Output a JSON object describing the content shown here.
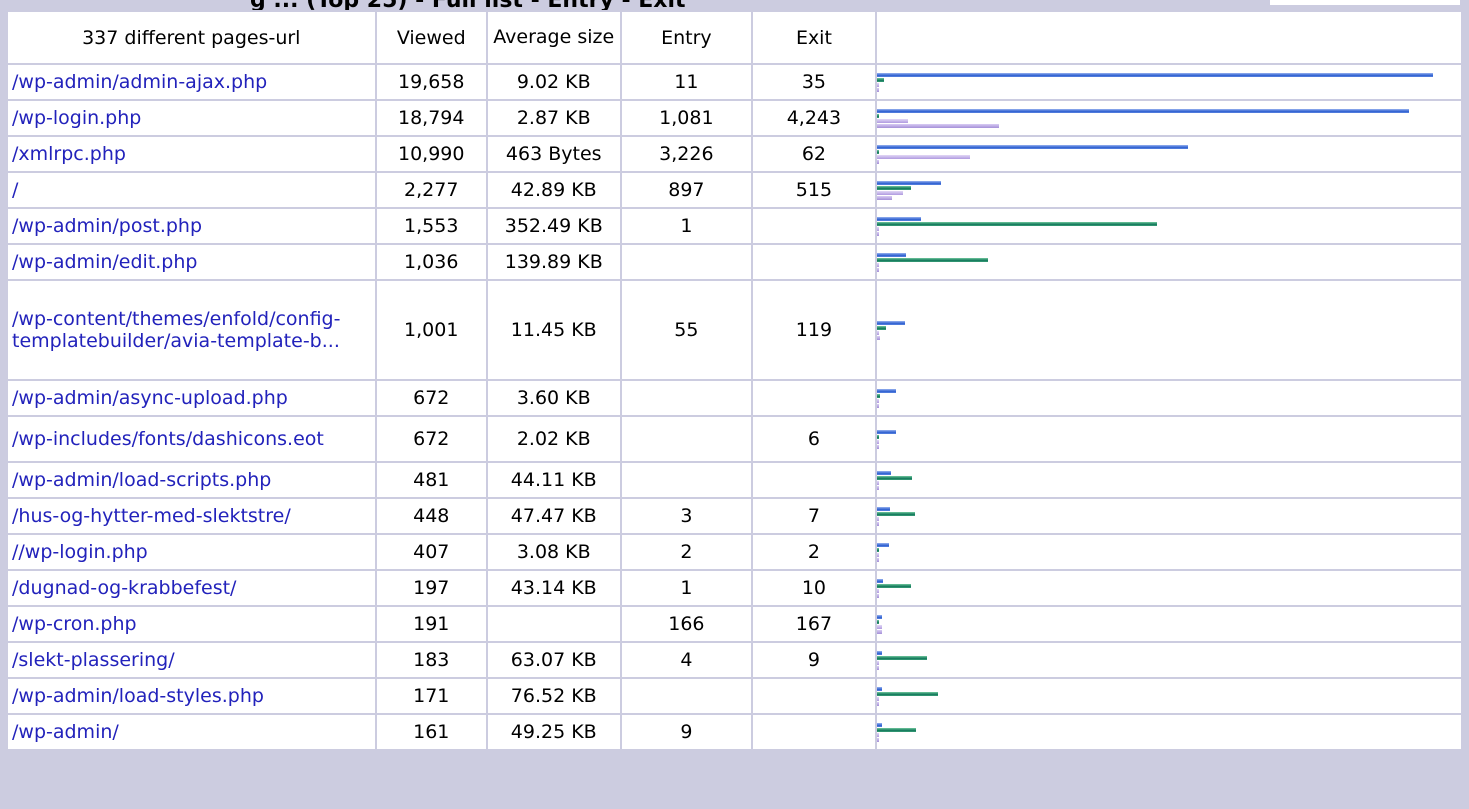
{
  "header_partial_title": "g ... (Top 25) - Full list - Entry - Exit",
  "table": {
    "headers": {
      "url": "337 different pages-url",
      "viewed": "Viewed",
      "size": "Average size",
      "entry": "Entry",
      "exit": "Exit"
    },
    "colors": {
      "viewed": "#4477dd",
      "size": "#2e9e5a",
      "entry": "#c9bde8",
      "exit": "#b8a8e0",
      "link": "#2222bb"
    },
    "rows": [
      {
        "url": "/wp-admin/admin-ajax.php",
        "viewed": "19,658",
        "size": "9.02 KB",
        "entry": "11",
        "exit": "35",
        "bv": 19658,
        "bs": 9.02,
        "be": 11,
        "bx": 35
      },
      {
        "url": "/wp-login.php",
        "viewed": "18,794",
        "size": "2.87 KB",
        "entry": "1,081",
        "exit": "4,243",
        "bv": 18794,
        "bs": 2.87,
        "be": 1081,
        "bx": 4243
      },
      {
        "url": "/xmlrpc.php",
        "viewed": "10,990",
        "size": "463 Bytes",
        "entry": "3,226",
        "exit": "62",
        "bv": 10990,
        "bs": 0.45,
        "be": 3226,
        "bx": 62
      },
      {
        "url": "/",
        "viewed": "2,277",
        "size": "42.89 KB",
        "entry": "897",
        "exit": "515",
        "bv": 2277,
        "bs": 42.89,
        "be": 897,
        "bx": 515
      },
      {
        "url": "/wp-admin/post.php",
        "viewed": "1,553",
        "size": "352.49 KB",
        "entry": "1",
        "exit": "",
        "bv": 1553,
        "bs": 352.49,
        "be": 1,
        "bx": 0
      },
      {
        "url": "/wp-admin/edit.php",
        "viewed": "1,036",
        "size": "139.89 KB",
        "entry": "",
        "exit": "",
        "bv": 1036,
        "bs": 139.89,
        "be": 0,
        "bx": 0
      },
      {
        "url": "/wp-content/themes/enfold/config-templatebuilder/avia-template-b...",
        "viewed": "1,001",
        "size": "11.45 KB",
        "entry": "55",
        "exit": "119",
        "bv": 1001,
        "bs": 11.45,
        "be": 55,
        "bx": 119
      },
      {
        "url": "/wp-admin/async-upload.php",
        "viewed": "672",
        "size": "3.60 KB",
        "entry": "",
        "exit": "",
        "bv": 672,
        "bs": 3.6,
        "be": 0,
        "bx": 0
      },
      {
        "url": "/wp-includes/fonts/dashicons.eot",
        "viewed": "672",
        "size": "2.02 KB",
        "entry": "",
        "exit": "6",
        "bv": 672,
        "bs": 2.02,
        "be": 0,
        "bx": 6
      },
      {
        "url": "/wp-admin/load-scripts.php",
        "viewed": "481",
        "size": "44.11 KB",
        "entry": "",
        "exit": "",
        "bv": 481,
        "bs": 44.11,
        "be": 0,
        "bx": 0
      },
      {
        "url": "/hus-og-hytter-med-slektstre/",
        "viewed": "448",
        "size": "47.47 KB",
        "entry": "3",
        "exit": "7",
        "bv": 448,
        "bs": 47.47,
        "be": 3,
        "bx": 7
      },
      {
        "url": "//wp-login.php",
        "viewed": "407",
        "size": "3.08 KB",
        "entry": "2",
        "exit": "2",
        "bv": 407,
        "bs": 3.08,
        "be": 2,
        "bx": 2
      },
      {
        "url": "/dugnad-og-krabbefest/",
        "viewed": "197",
        "size": "43.14 KB",
        "entry": "1",
        "exit": "10",
        "bv": 197,
        "bs": 43.14,
        "be": 1,
        "bx": 10
      },
      {
        "url": "/wp-cron.php",
        "viewed": "191",
        "size": "",
        "entry": "166",
        "exit": "167",
        "bv": 191,
        "bs": 0,
        "be": 166,
        "bx": 167
      },
      {
        "url": "/slekt-plassering/",
        "viewed": "183",
        "size": "63.07 KB",
        "entry": "4",
        "exit": "9",
        "bv": 183,
        "bs": 63.07,
        "be": 4,
        "bx": 9
      },
      {
        "url": "/wp-admin/load-styles.php",
        "viewed": "171",
        "size": "76.52 KB",
        "entry": "",
        "exit": "",
        "bv": 171,
        "bs": 76.52,
        "be": 0,
        "bx": 0
      },
      {
        "url": "/wp-admin/",
        "viewed": "161",
        "size": "49.25 KB",
        "entry": "9",
        "exit": "",
        "bv": 161,
        "bs": 49.25,
        "be": 9,
        "bx": 0
      }
    ]
  }
}
